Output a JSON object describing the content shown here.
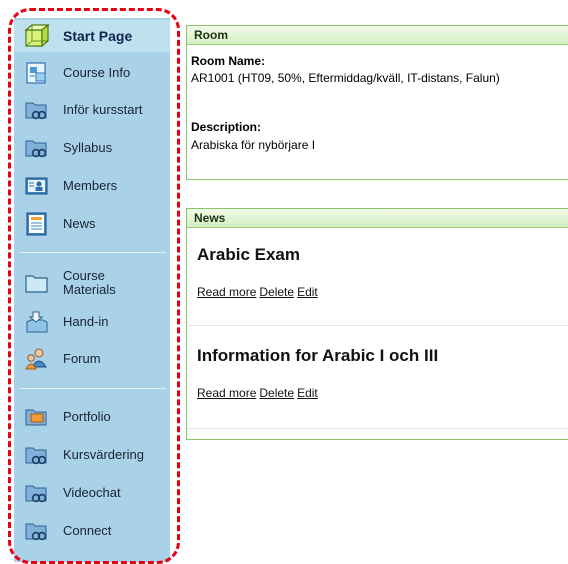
{
  "sidebar": {
    "items": [
      {
        "label": "Start Page",
        "icon": "start-page-cube-icon"
      },
      {
        "label": "Course Info",
        "icon": "course-info-icon"
      },
      {
        "label": "Inför kursstart",
        "icon": "folder-link-icon"
      },
      {
        "label": "Syllabus",
        "icon": "folder-link-icon"
      },
      {
        "label": "Members",
        "icon": "members-card-icon"
      },
      {
        "label": "News",
        "icon": "news-page-icon"
      },
      {
        "label": "Course\nMaterials",
        "icon": "folder-icon"
      },
      {
        "label": "Hand-in",
        "icon": "hand-in-tray-icon"
      },
      {
        "label": "Forum",
        "icon": "forum-people-icon"
      },
      {
        "label": "Portfolio",
        "icon": "portfolio-folder-icon"
      },
      {
        "label": "Kursvärdering",
        "icon": "folder-link-icon"
      },
      {
        "label": "Videochat",
        "icon": "folder-link-icon"
      },
      {
        "label": "Connect",
        "icon": "folder-link-icon"
      }
    ]
  },
  "room": {
    "header": "Room",
    "name_label": "Room Name:",
    "name_value": "AR1001 (HT09, 50%, Eftermiddag/kväll, IT-distans, Falun)",
    "desc_label": "Description:",
    "desc_value": "Arabiska för nybörjare I"
  },
  "news": {
    "header": "News",
    "items": [
      {
        "title": "Arabic Exam",
        "read_more": "Read more",
        "delete": "Delete",
        "edit": "Edit"
      },
      {
        "title": "Information for Arabic I och III",
        "read_more": "Read more",
        "delete": "Delete",
        "edit": "Edit"
      }
    ]
  },
  "colors": {
    "sidebar_bg": "#a9d2e8",
    "highlight_dash": "#e60012",
    "panel_border": "#8cc46a"
  }
}
